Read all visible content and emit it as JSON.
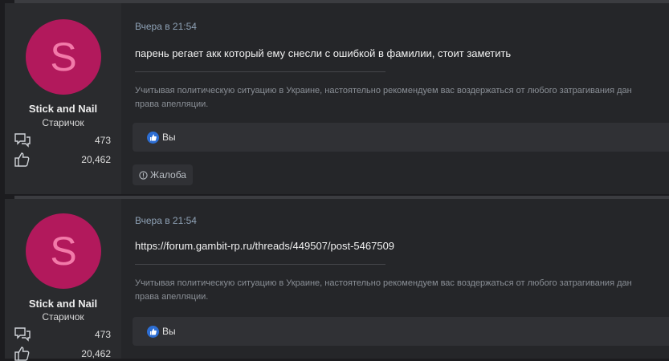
{
  "posts": [
    {
      "avatar_letter": "S",
      "username": "Stick and Nail",
      "user_title": "Старичок",
      "messages_count": "473",
      "reactions_count": "20,462",
      "date": "Вчера в 21:54",
      "message": "парень регает акк который ему снесли с ошибкой в фамилии, стоит заметить",
      "signature_line1": "Учитывая политическую ситуацию в Украине, настоятельно рекомендуем вас воздержаться от любого затрагивания дан",
      "signature_line2": "права апелляции.",
      "reaction_label": "Вы",
      "report_label": "Жалоба"
    },
    {
      "avatar_letter": "S",
      "username": "Stick and Nail",
      "user_title": "Старичок",
      "messages_count": "473",
      "reactions_count": "20,462",
      "date": "Вчера в 21:54",
      "message": "https://forum.gambit-rp.ru/threads/449507/post-5467509",
      "signature_line1": "Учитывая политическую ситуацию в Украине, настоятельно рекомендуем вас воздержаться от любого затрагивания дан",
      "signature_line2": "права апелляции.",
      "reaction_label": "Вы"
    }
  ],
  "colors": {
    "avatar_bg": "#b2195c",
    "avatar_letter": "#f27aa9",
    "date": "#8fa2b6",
    "like": "#2d6ed3"
  },
  "icons": {
    "messages": "speech-bubbles-icon",
    "reactions": "thumbs-up-icon",
    "like": "like-icon",
    "report": "info-circle-icon"
  }
}
